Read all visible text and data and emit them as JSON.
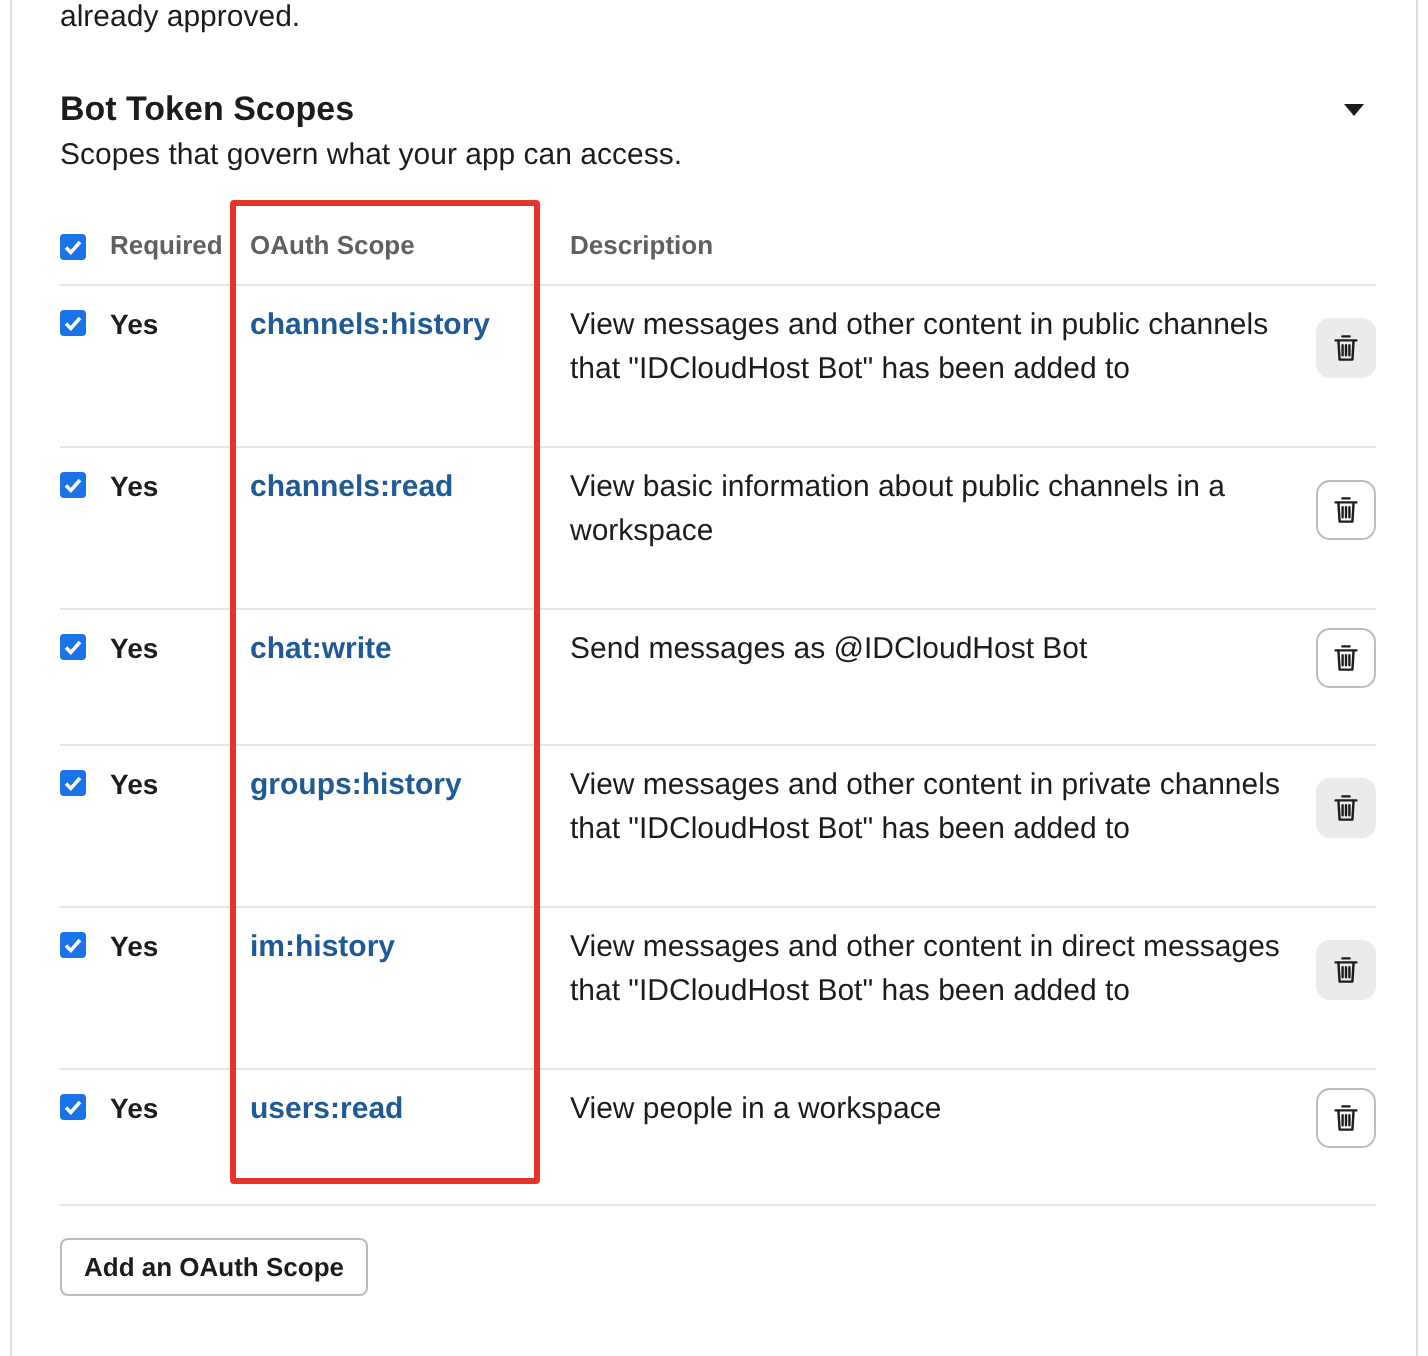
{
  "intro": {
    "text": "already approved."
  },
  "section": {
    "title": "Bot Token Scopes",
    "subtitle": "Scopes that govern what your app can access.",
    "expanded": true
  },
  "table": {
    "header_checkbox": {
      "checked": true
    },
    "columns": [
      {
        "label": "Required",
        "highlighted": false
      },
      {
        "label": "OAuth Scope",
        "highlighted": true
      },
      {
        "label": "Description",
        "highlighted": false
      }
    ],
    "rows": [
      {
        "checked": true,
        "required": "Yes",
        "scope": "channels:history",
        "description": "View messages and other content in public channels that \"IDCloudHost Bot\" has been added to",
        "delete_disabled": true
      },
      {
        "checked": true,
        "required": "Yes",
        "scope": "channels:read",
        "description": "View basic information about public channels in a workspace",
        "delete_disabled": false
      },
      {
        "checked": true,
        "required": "Yes",
        "scope": "chat:write",
        "description": "Send messages as @IDCloudHost Bot",
        "delete_disabled": false
      },
      {
        "checked": true,
        "required": "Yes",
        "scope": "groups:history",
        "description": "View messages and other content in private channels that \"IDCloudHost Bot\" has been added to",
        "delete_disabled": true
      },
      {
        "checked": true,
        "required": "Yes",
        "scope": "im:history",
        "description": "View messages and other content in direct messages that \"IDCloudHost Bot\" has been added to",
        "delete_disabled": true
      },
      {
        "checked": true,
        "required": "Yes",
        "scope": "users:read",
        "description": "View people in a workspace",
        "delete_disabled": false
      }
    ]
  },
  "add_button": {
    "label": "Add an OAuth Scope"
  }
}
